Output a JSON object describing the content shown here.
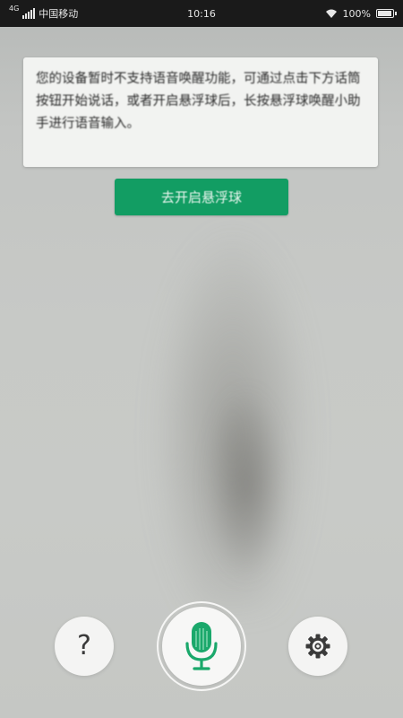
{
  "status_bar": {
    "network_type": "4G",
    "carrier": "中国移动",
    "time": "10:16",
    "battery": "100%",
    "battery_level": 1.0
  },
  "message": {
    "text": "您的设备暂时不支持语音唤醒功能，可通过点击下方话筒按钮开始说话，或者开启悬浮球后，长按悬浮球唤醒小助手进行语音输入。"
  },
  "action_button": {
    "label": "去开启悬浮球"
  },
  "controls": {
    "help_label": "?"
  },
  "colors": {
    "accent": "#129d63",
    "mic": "#1aa86b",
    "card": "#f2f3f1",
    "status_bar": "#1a1a1a"
  },
  "icons": {
    "help": "question-icon",
    "mic": "microphone-icon",
    "settings": "gear-icon"
  }
}
